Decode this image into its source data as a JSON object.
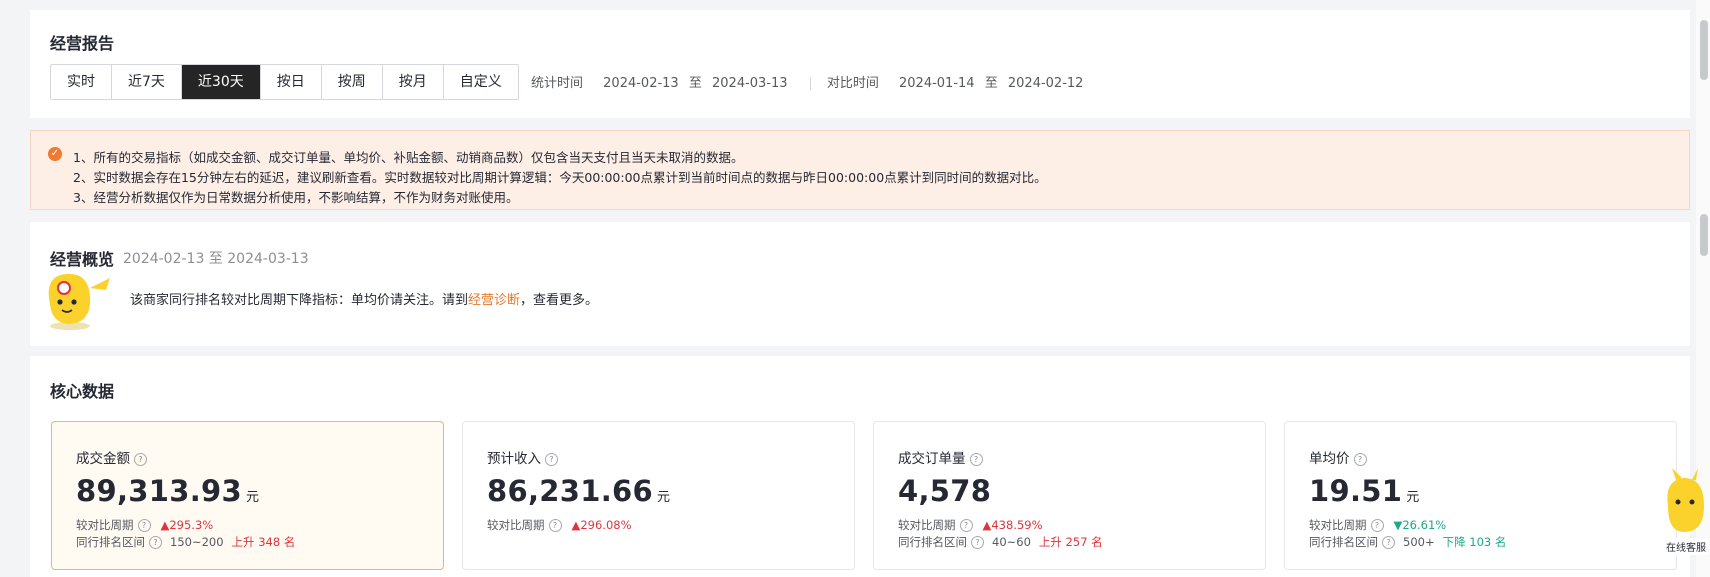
{
  "report": {
    "title": "经营报告",
    "tabs": [
      {
        "label": "实时",
        "active": false
      },
      {
        "label": "近7天",
        "active": false
      },
      {
        "label": "近30天",
        "active": true
      },
      {
        "label": "按日",
        "active": false
      },
      {
        "label": "按周",
        "active": false
      },
      {
        "label": "按月",
        "active": false
      },
      {
        "label": "自定义",
        "active": false
      }
    ],
    "stat_label": "统计时间",
    "stat_start": "2024-02-13",
    "to": "至",
    "stat_end": "2024-03-13",
    "compare_label": "对比时间",
    "compare_start": "2024-01-14",
    "compare_end": "2024-02-12"
  },
  "notice": {
    "icon": "check-circle-icon",
    "lines": [
      "1、所有的交易指标（如成交金额、成交订单量、单均价、补贴金额、动销商品数）仅包含当天支付且当天未取消的数据。",
      "2、实时数据会存在15分钟左右的延迟，建议刷新查看。实时数据较对比周期计算逻辑：今天00:00:00点累计到当前时间点的数据与昨日00:00:00点累计到同时间的数据对比。",
      "3、经营分析数据仅作为日常数据分析使用，不影响结算，不作为财务对账使用。"
    ]
  },
  "overview": {
    "title": "经营概览",
    "date_range": "2024-02-13 至 2024-03-13",
    "message_pre": "该商家同行排名较对比周期下降指标：单均价请关注。请到",
    "message_link": "经营诊断",
    "message_post": "，查看更多。"
  },
  "core": {
    "title": "核心数据",
    "cards": [
      {
        "label": "成交金额",
        "value": "89,313.93",
        "unit": "元",
        "compare_label": "较对比周期",
        "compare_value": "295.3%",
        "compare_dir": "up",
        "rank_label": "同行排名区间",
        "rank_range": "150~200",
        "rank_change": "上升 348 名",
        "rank_dir": "up",
        "active": true
      },
      {
        "label": "预计收入",
        "value": "86,231.66",
        "unit": "元",
        "compare_label": "较对比周期",
        "compare_value": "296.08%",
        "compare_dir": "up",
        "active": false
      },
      {
        "label": "成交订单量",
        "value": "4,578",
        "unit": "",
        "compare_label": "较对比周期",
        "compare_value": "438.59%",
        "compare_dir": "up",
        "rank_label": "同行排名区间",
        "rank_range": "40~60",
        "rank_change": "上升 257 名",
        "rank_dir": "up",
        "active": false
      },
      {
        "label": "单均价",
        "value": "19.51",
        "unit": "元",
        "compare_label": "较对比周期",
        "compare_value": "26.61%",
        "compare_dir": "down",
        "rank_label": "同行排名区间",
        "rank_range": "500+",
        "rank_change": "下降 103 名",
        "rank_dir": "down",
        "active": false
      }
    ]
  },
  "side_widget": {
    "label": "在线客服"
  },
  "colors": {
    "accent": "#e47a2c",
    "up": "#e0343c",
    "down": "#1fa88a",
    "active_tab": "#252525"
  }
}
